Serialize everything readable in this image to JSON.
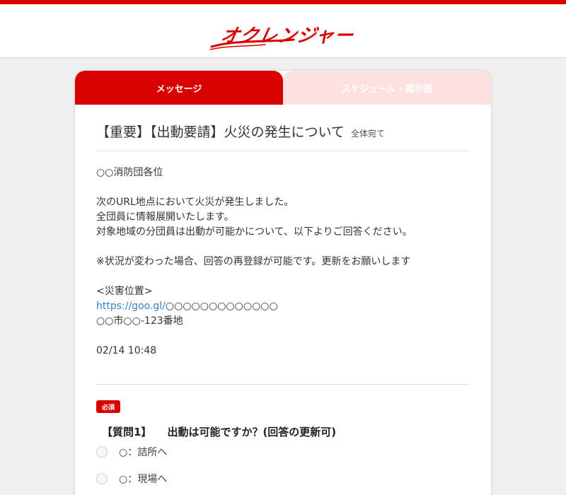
{
  "header": {
    "logo_text": "オクレンジャー",
    "brand_color": "#d90000"
  },
  "tabs": [
    {
      "label": "メッセージ",
      "active": true
    },
    {
      "label": "スケジュール・掲示板",
      "active": false
    }
  ],
  "message": {
    "subject": "【重要】【出動要請】火災の発生について",
    "recipient": "全体宛て",
    "greeting": "○○消防団各位",
    "paragraph1": [
      "次のURL地点において火災が発生しました。",
      "全団員に情報展開いたします。",
      "対象地域の分団員は出動が可能かについて、以下よりご回答ください。"
    ],
    "note": "※状況が変わった場合、回答の再登録が可能です。更新をお願いします",
    "location_heading": "<災害位置>",
    "location_link_prefix": "https://goo.gl/",
    "location_link_suffix": "○○○○○○○○○○○○○",
    "address": "○○市○○-123番地",
    "timestamp": "02/14 10:48"
  },
  "question": {
    "required_label": "必須",
    "number": "【質問1】",
    "text": "出動は可能ですか？(回答の更新可)",
    "options": [
      {
        "label": "○：詰所へ"
      },
      {
        "label": "○：現場へ"
      }
    ]
  }
}
